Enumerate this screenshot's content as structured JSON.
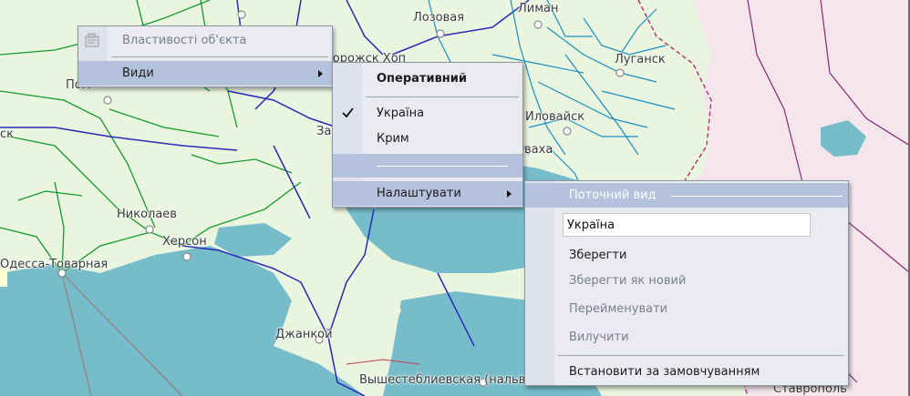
{
  "map": {
    "labels": {
      "lozovaya": "Лозовая",
      "liman": "Лиман",
      "lugansk": "Луганск",
      "ilovaysk": "Иловайск",
      "hidden_top": "Запорожск Хоп",
      "zaporozh_part": "За",
      "vaha_part": "ваха",
      "left_part": "Пом",
      "sk_part": "ск",
      "nikolaev": "Николаев",
      "herson": "Херсон",
      "odessa": "Одесса-Товарная",
      "dzhankoy": "Джанкой",
      "vyshesteblievskaya": "Вышестеблиевская (нальв. эксп.)",
      "bottom_right": "Ставрополь"
    },
    "colors": {
      "land": "#eaf5e0",
      "sea": "#77bcca",
      "russia": "#f5e6ee",
      "rail_main": "#2a2ab8",
      "rail_local": "#139a2c",
      "rail_donbas": "#1a8fc2",
      "border": "#b03070",
      "rail_russia": "#8a2a70"
    }
  },
  "context_menu": {
    "properties": "Властивості об'єкта",
    "views": "Види"
  },
  "views_menu": {
    "operative": "Оперативний",
    "ukraine": "Україна",
    "crimea": "Крим",
    "settings": "Налаштувати"
  },
  "settings_menu": {
    "header": "Поточний вид",
    "name_value": "Україна",
    "save": "Зберегти",
    "save_as_new": "Зберегти як новий",
    "rename": "Перейменувати",
    "delete": "Вилучити",
    "set_default": "Встановити за замовчуванням"
  }
}
